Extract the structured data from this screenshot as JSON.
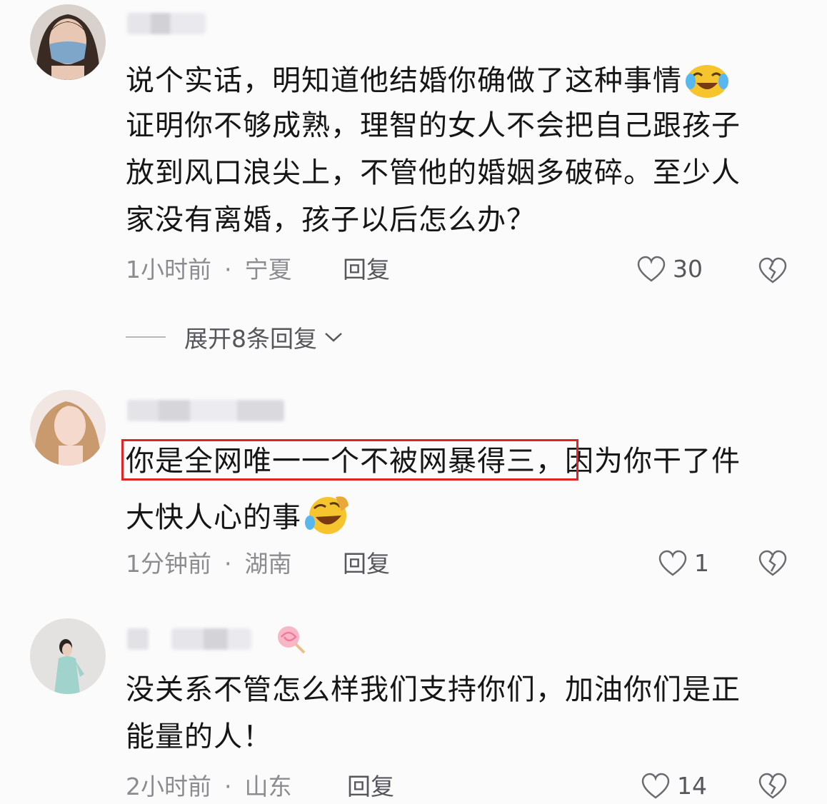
{
  "comments": [
    {
      "lines": [
        "说个实话，明知道他结婚你确做了这种事情",
        "证明你不够成熟，理智的女人不会把自己跟孩子",
        "放到风口浪尖上，不管他的婚姻多破碎。至少人",
        "家没有离婚，孩子以后怎么办？"
      ],
      "time": "1小时前",
      "dot": "·",
      "location": "宁夏",
      "reply_label": "回复",
      "likes": "30",
      "expand_label": "展开8条回复"
    },
    {
      "lines": [
        "你是全网唯一一个不被网暴得三，因为你干了件",
        "大快人心的事"
      ],
      "time": "1分钟前",
      "dot": "·",
      "location": "湖南",
      "reply_label": "回复",
      "likes": "1"
    },
    {
      "lines": [
        "没关系不管怎么样我们支持你们，加油你们是正",
        "能量的人！"
      ],
      "time": "2小时前",
      "dot": "·",
      "location": "山东",
      "reply_label": "回复",
      "likes": "14"
    }
  ],
  "icons": {
    "like": "heart-outline-icon",
    "dislike": "broken-heart-icon",
    "expand": "chevron-down-icon",
    "emoji_1": "laughing-crying-emoji",
    "emoji_2": "rolling-laughing-emoji",
    "sticker": "lollipop-icon"
  },
  "colors": {
    "background": "#fbfbfc",
    "text": "#161616",
    "meta": "#8c8c90",
    "highlight": "#e02424"
  }
}
